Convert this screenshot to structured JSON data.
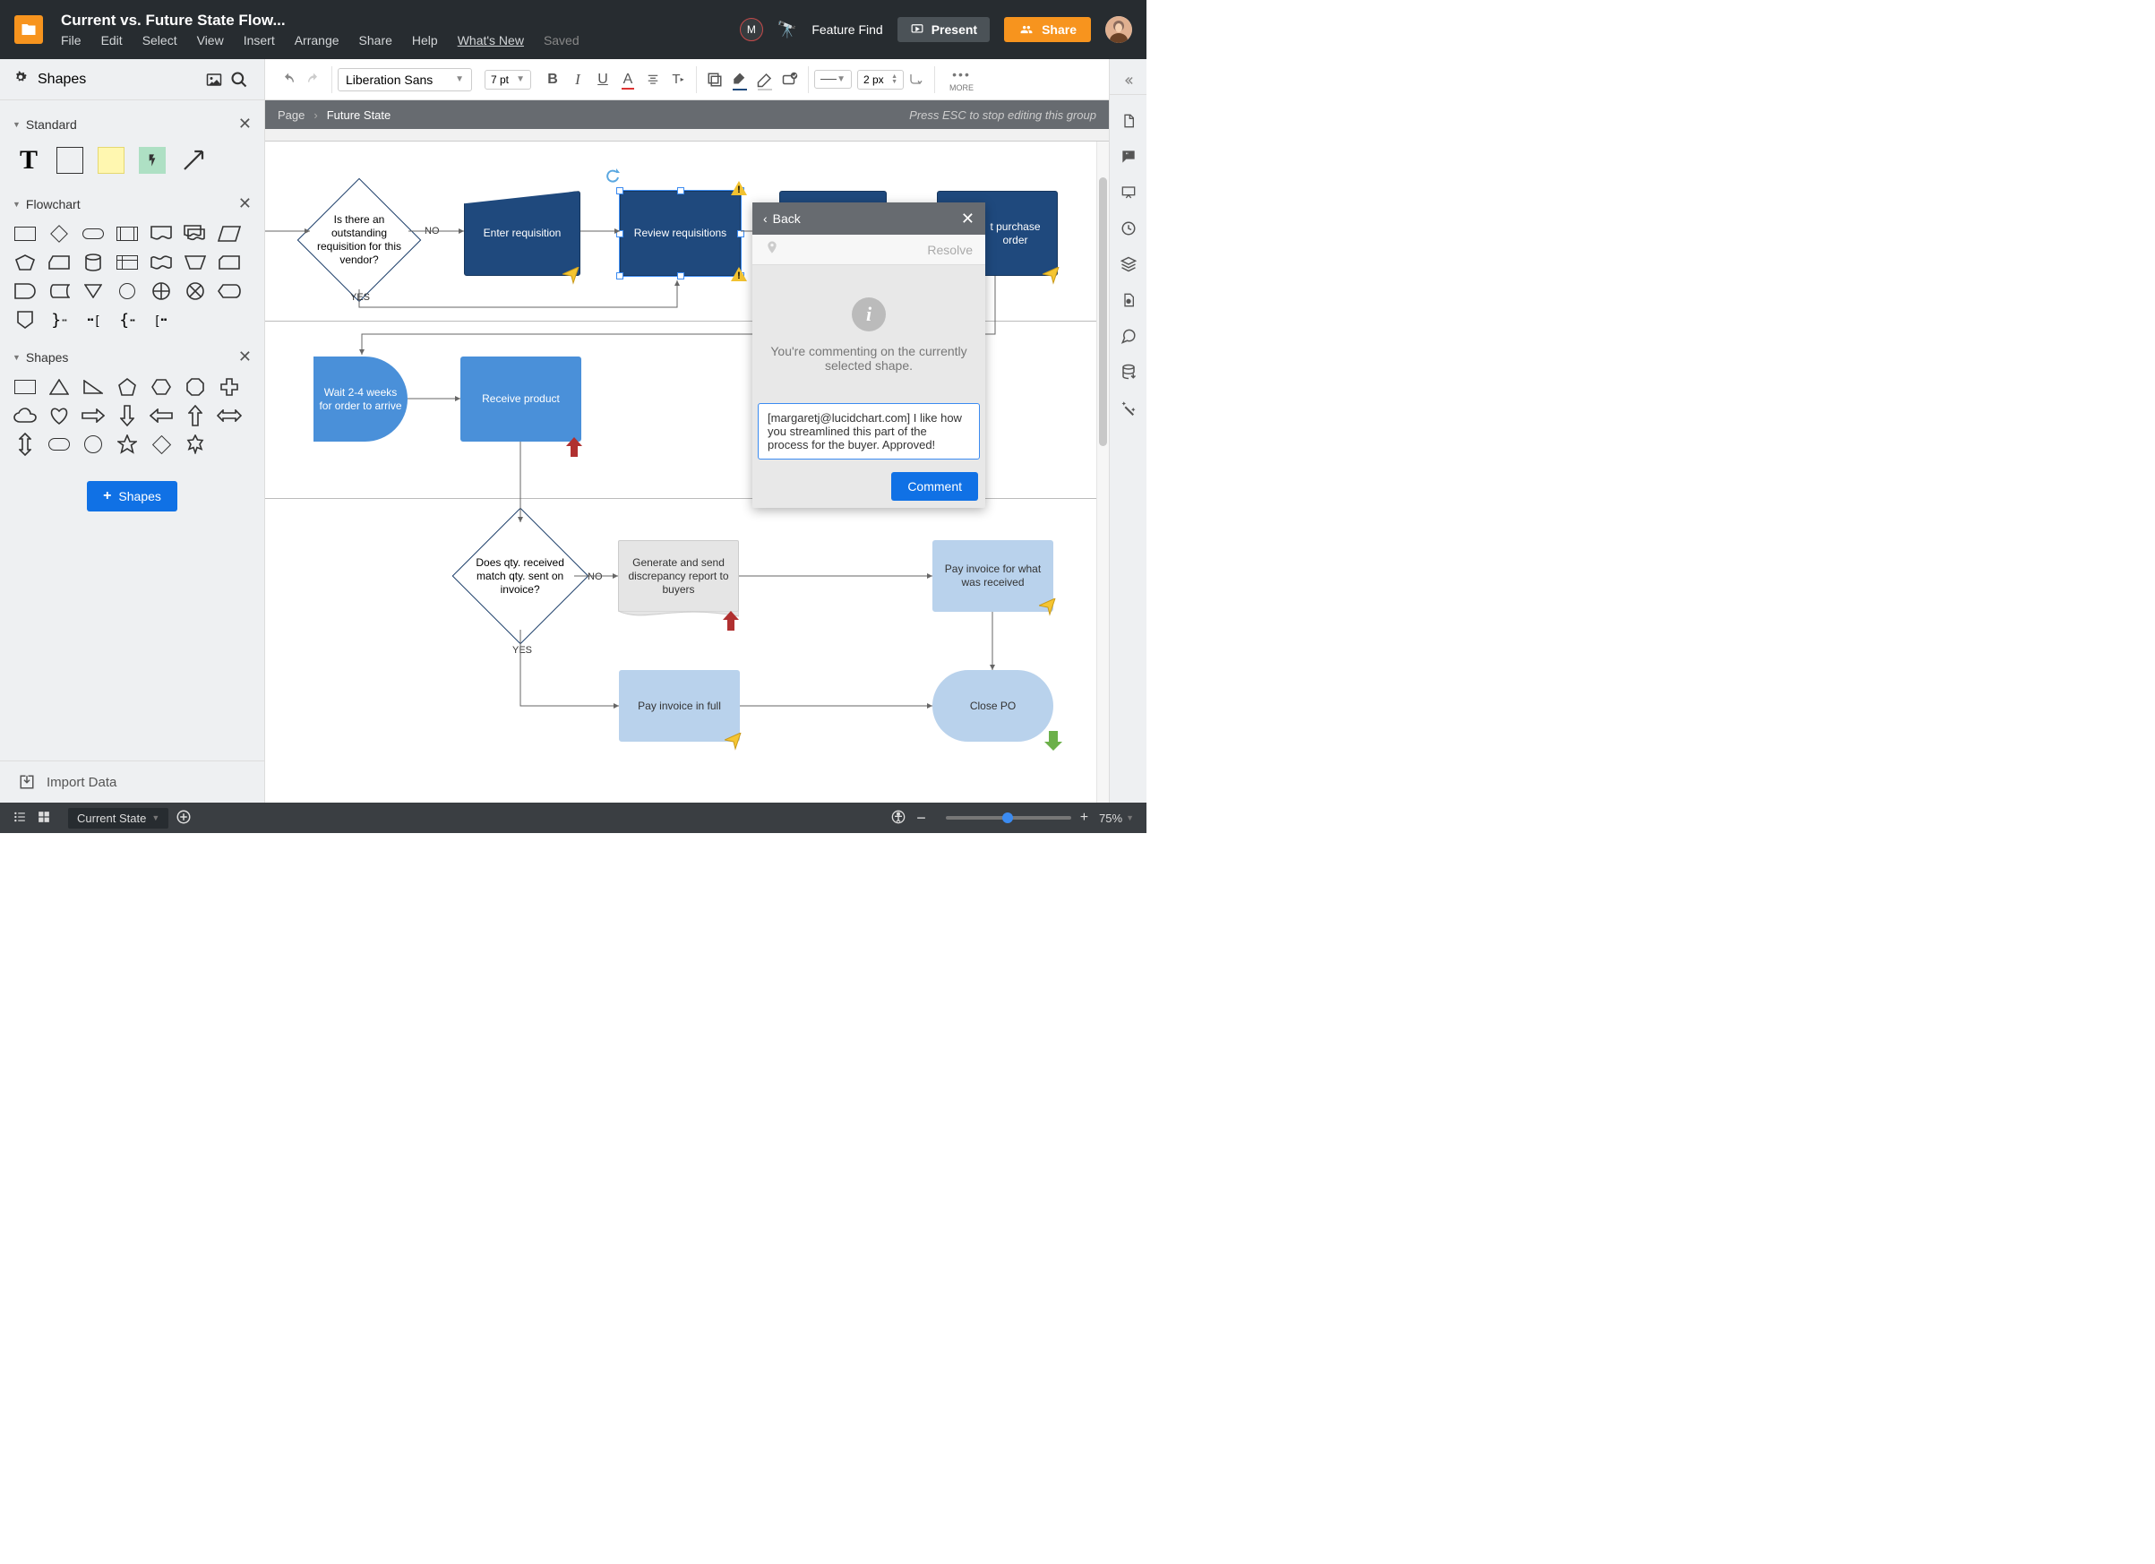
{
  "header": {
    "doc_title": "Current vs. Future State Flow...",
    "menu": [
      "File",
      "Edit",
      "Select",
      "View",
      "Insert",
      "Arrange",
      "Share",
      "Help"
    ],
    "whatsnew": "What's New",
    "saved": "Saved",
    "avatar_letter": "M",
    "feature_find": "Feature Find",
    "present": "Present",
    "share": "Share"
  },
  "toolbar": {
    "font": "Liberation Sans",
    "font_size": "7 pt",
    "line_width": "2 px",
    "more": "MORE"
  },
  "left": {
    "shapes": "Shapes",
    "standard": "Standard",
    "flowchart": "Flowchart",
    "shapes_section": "Shapes",
    "add_shapes_btn": "Shapes",
    "import": "Import Data"
  },
  "breadcrumb": {
    "page": "Page",
    "current": "Future State",
    "hint": "Press ESC to stop editing this group"
  },
  "nodes": {
    "decision1": "Is there an outstanding requisition for this vendor?",
    "no": "NO",
    "yes": "YES",
    "enter_req": "Enter requisition",
    "review_req": "Review requisitions",
    "purchase_order": "t purchase order",
    "wait_order": "Wait 2-4 weeks for order to arrive",
    "receive_product": "Receive product",
    "decision2": "Does qty. received match qty. sent on invoice?",
    "generate_report": "Generate and send discrepancy report to buyers",
    "pay_received": "Pay invoice for what was received",
    "pay_full": "Pay invoice in full",
    "close_po": "Close PO"
  },
  "comment": {
    "back": "Back",
    "resolve": "Resolve",
    "info_text": "You're commenting on the currently selected shape.",
    "input_value": "[margaretj@lucidchart.com] I like how you streamlined this part of the process for the buyer. Approved!",
    "submit": "Comment"
  },
  "bottom": {
    "current_tab": "Current State",
    "zoom_percent": "75%"
  }
}
